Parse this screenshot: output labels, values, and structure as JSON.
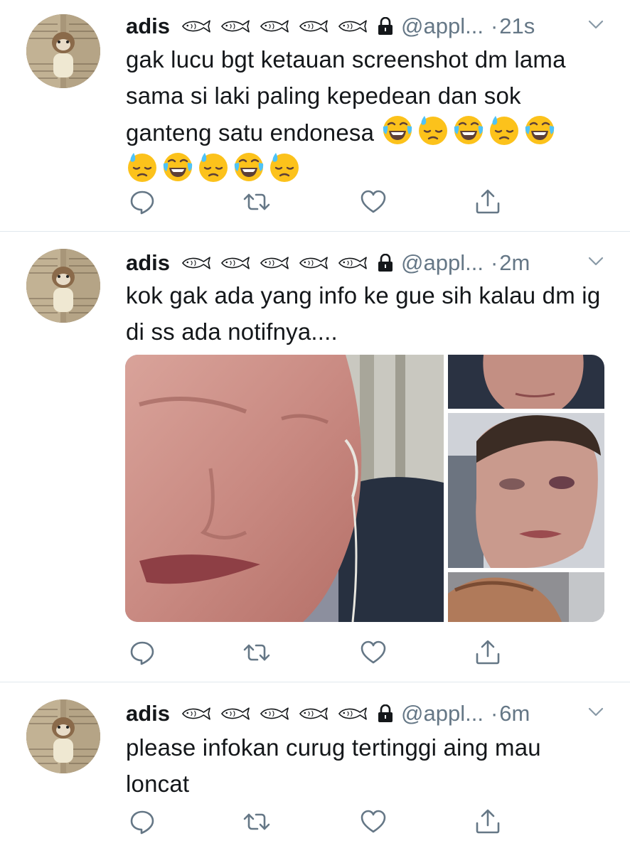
{
  "tweets": [
    {
      "name": "adis",
      "handle": "@appl...",
      "dot": "·",
      "time": "21s",
      "text": "gak lucu bgt ketauan screenshot dm lama sama si laki paling kepedean dan sok ganteng satu endonesa",
      "emojis": [
        "joy-emoji",
        "downcast-sweat-emoji",
        "joy-emoji",
        "downcast-sweat-emoji",
        "joy-emoji",
        "downcast-sweat-emoji",
        "joy-emoji",
        "downcast-sweat-emoji",
        "joy-emoji",
        "downcast-sweat-emoji"
      ],
      "has_media": false
    },
    {
      "name": "adis",
      "handle": "@appl...",
      "dot": "·",
      "time": "2m",
      "text": "kok gak ada yang info ke gue sih kalau dm ig di ss ada notifnya....",
      "emojis": [],
      "has_media": true
    },
    {
      "name": "adis",
      "handle": "@appl...",
      "dot": "·",
      "time": "6m",
      "text": "please infokan curug tertinggi aing mau loncat",
      "emojis": [],
      "has_media": false
    }
  ],
  "header_icons": [
    "fish-icon",
    "fish-icon",
    "fish-icon",
    "fish-icon",
    "fish-icon",
    "lock-icon"
  ],
  "action_icons": [
    "reply-icon",
    "retweet-icon",
    "like-icon",
    "share-icon"
  ],
  "colors": {
    "text": "#14171a",
    "secondary": "#657786",
    "divider": "#e1e8ed"
  }
}
